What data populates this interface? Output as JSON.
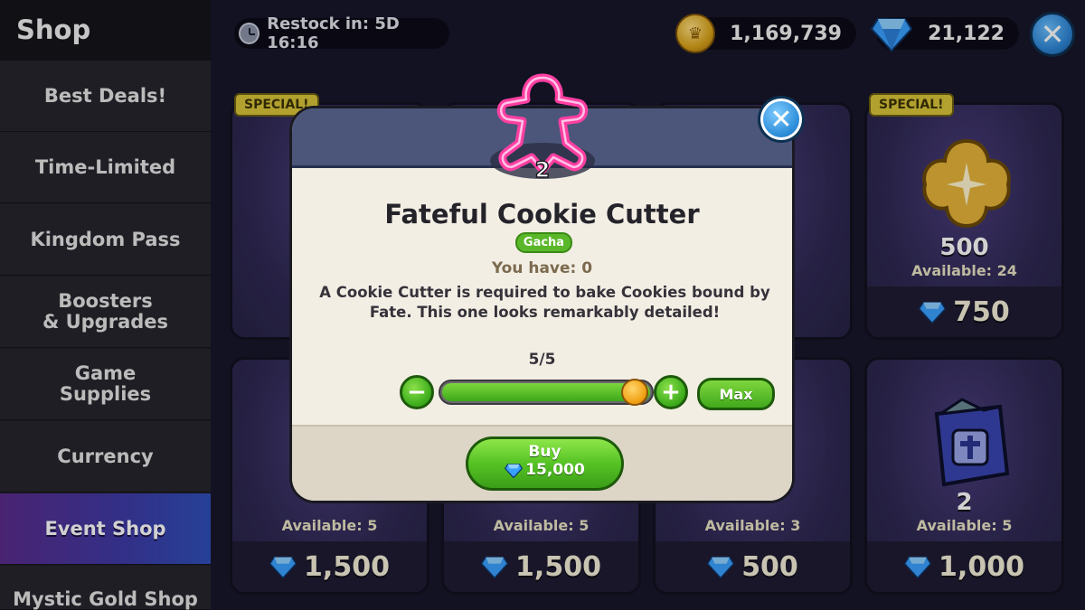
{
  "sidebar": {
    "title": "Shop",
    "items": [
      {
        "label": "Best Deals!"
      },
      {
        "label": "Time-Limited"
      },
      {
        "label": "Kingdom Pass"
      },
      {
        "label": "Boosters\n& Upgrades"
      },
      {
        "label": "Game\nSupplies"
      },
      {
        "label": "Currency"
      },
      {
        "label": "Event Shop"
      },
      {
        "label": "Mystic Gold Shop"
      }
    ],
    "active_index": 6
  },
  "topbar": {
    "restock": "Restock in: 5D 16:16",
    "coins": "1,169,739",
    "gems": "21,122"
  },
  "cards": [
    {
      "badge": "SPECIAL!",
      "qty": "500",
      "available": "Available: 24",
      "price": "750"
    },
    {
      "badge": "",
      "qty": "2",
      "available": "Available: 5",
      "price": "1,000"
    },
    {
      "available": "Available: 5",
      "price": "1,500"
    },
    {
      "available": "Available: 5",
      "price": "1,500"
    },
    {
      "available": "Available: 3",
      "price": "500"
    },
    {
      "badge": "SPECIAL!"
    }
  ],
  "modal": {
    "icon_count": "2",
    "title": "Fateful Cookie Cutter",
    "badge": "Gacha",
    "you_have": "You have: 0",
    "description": "A Cookie Cutter is required to bake Cookies bound by Fate. This one looks remarkably detailed!",
    "count": "5/5",
    "slider_fraction": 1.0,
    "minus": "−",
    "plus": "+",
    "max_label": "Max",
    "buy_label": "Buy",
    "buy_price": "15,000"
  },
  "colors": {
    "accent_green": "#55c224",
    "gem_blue": "#3aa0ff",
    "special_yellow": "#d9c53a"
  }
}
